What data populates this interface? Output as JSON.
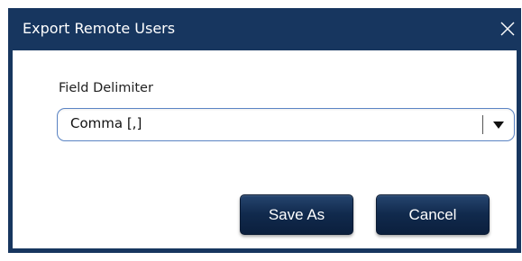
{
  "dialog": {
    "title": "Export Remote Users",
    "close_icon": "close-icon"
  },
  "form": {
    "field_label": "Field Delimiter",
    "delimiter_value": "Comma [,]",
    "dropdown_icon": "chevron-down-icon"
  },
  "buttons": {
    "save_as": "Save As",
    "cancel": "Cancel"
  },
  "colors": {
    "titlebar": "#17365f",
    "button": "#112a4d",
    "select_border": "#5b84c4"
  }
}
